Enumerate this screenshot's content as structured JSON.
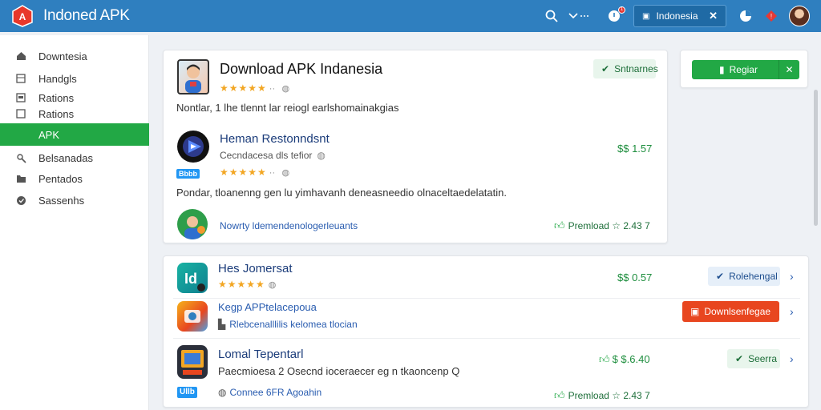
{
  "header": {
    "brand": "Indoned APK",
    "locale_label": "Indonesia",
    "notification_count": "1",
    "colors": {
      "bar": "#2f7fbf",
      "accent_green": "#22a845",
      "accent_red": "#e8461f"
    }
  },
  "sidebar": {
    "items": [
      {
        "label": "Downtesia",
        "icon": "home-icon"
      },
      {
        "label": "Handgls",
        "icon": "grid-icon"
      },
      {
        "label": "Rations",
        "icon": "box-icon"
      },
      {
        "label": "Rations",
        "icon": "box-icon"
      },
      {
        "label": "APK",
        "icon": "apk-icon",
        "active": true
      },
      {
        "label": "Belsanadas",
        "icon": "tools-icon"
      },
      {
        "label": "Pentados",
        "icon": "folder-icon"
      },
      {
        "label": "Sassenhs",
        "icon": "shield-icon"
      }
    ]
  },
  "featured": {
    "title": "Download APK Indanesia",
    "rating_meta": "··",
    "desc": "Nontlar, 1 lhe tlennt lar  reiogl earlshomainakgias",
    "badge": "Sntnarnes"
  },
  "featured_app": {
    "name": "Heman Restonndsnt",
    "sub": "Cecndacesa dls tefior",
    "tag": "Bbbb",
    "rating_meta": "··",
    "price": "$$ 1.57",
    "desc": "Pondar, tloanenng gen lu yimhavanh deneasneedio olnaceltaedelatatin.",
    "link": "Nowrty ldemendenologerleuants",
    "download": "Premload ☆ 2.43 7"
  },
  "side_panel": {
    "button": "Regiar"
  },
  "list": [
    {
      "name": "Hes Jomersat",
      "price": "$$ 0.57",
      "action": "Rolehengal",
      "action_style": "blue"
    },
    {
      "name": "Kegp APPtelacepoua",
      "sub": "Rlebcenalllilis kelomea tlocian",
      "action": "Downlsenfegae",
      "action_style": "red"
    },
    {
      "name": "Lomal Tepentarl",
      "desc": "Paecmioesa 2 Osecnd ioceraecer eg n tkaoncenp Q",
      "price": "$ $.6.40",
      "action": "Seerra",
      "action_style": "green",
      "tag": "Ullb",
      "link": "Connee 6FR Agoahin",
      "download": "Premload ☆ 2.43 7"
    }
  ]
}
